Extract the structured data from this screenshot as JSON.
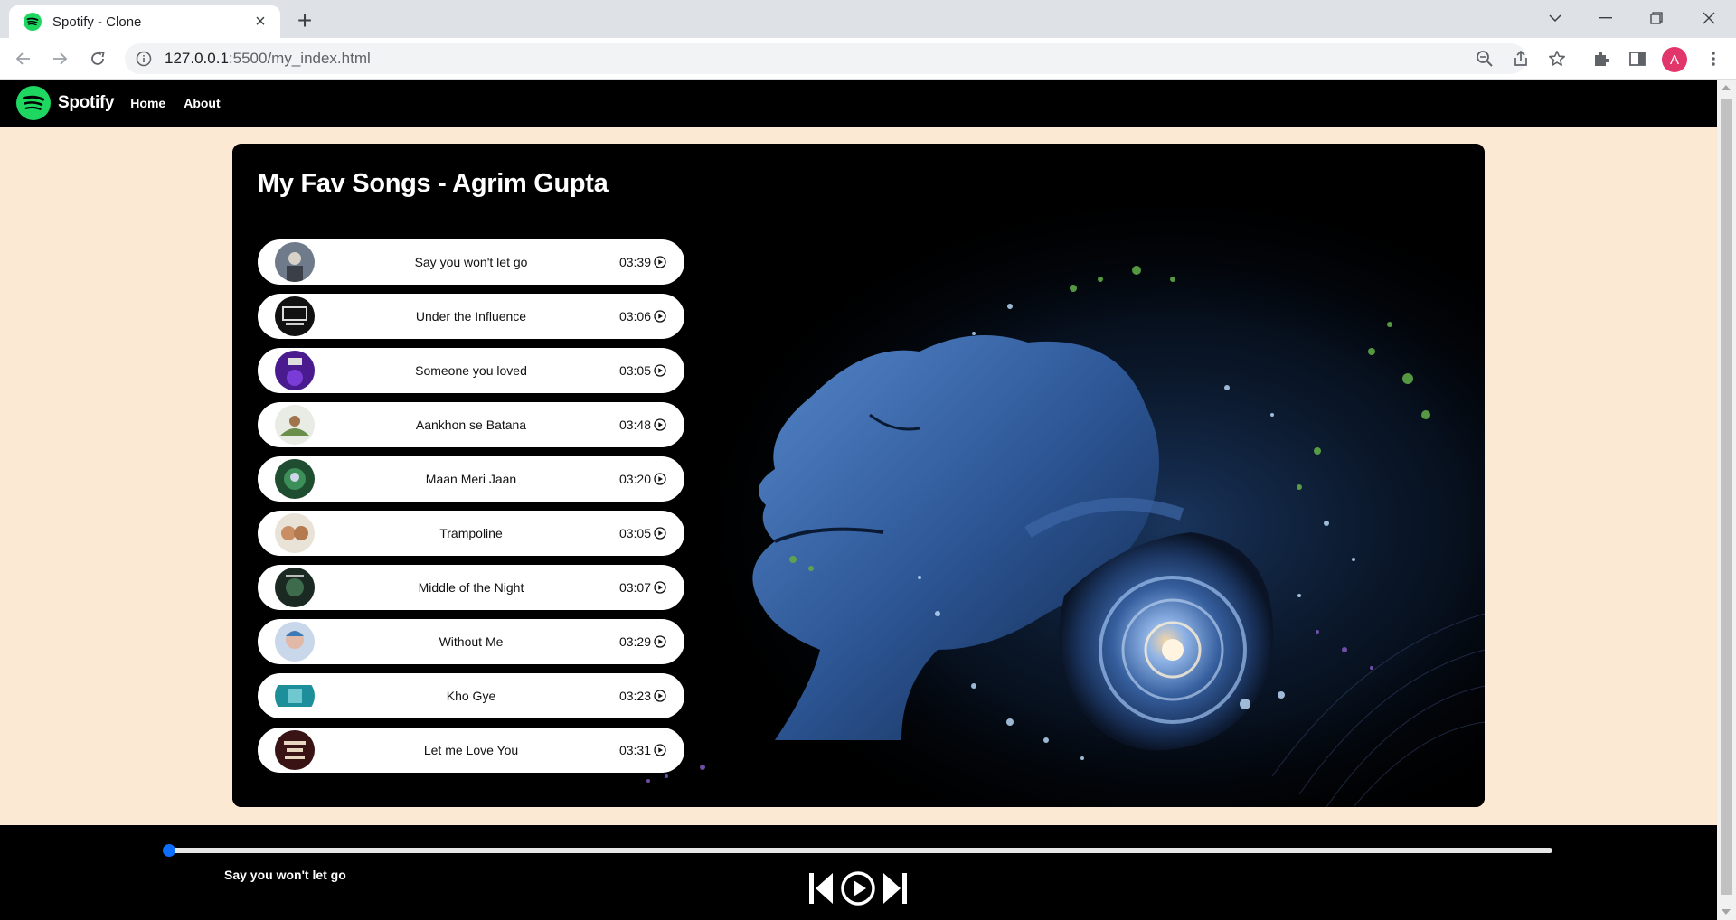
{
  "browser": {
    "tab_title": "Spotify - Clone",
    "url_host": "127.0.0.1",
    "url_rest": ":5500/my_index.html",
    "profile_initial": "A"
  },
  "site": {
    "brand": "Spotify",
    "nav": [
      {
        "label": "Home"
      },
      {
        "label": "About"
      }
    ]
  },
  "main": {
    "title": "My Fav Songs - Agrim Gupta",
    "songs": [
      {
        "name": "Say you won't let go",
        "duration": "03:39"
      },
      {
        "name": "Under the Influence",
        "duration": "03:06"
      },
      {
        "name": "Someone you loved",
        "duration": "03:05"
      },
      {
        "name": "Aankhon se Batana",
        "duration": "03:48"
      },
      {
        "name": "Maan Meri Jaan",
        "duration": "03:20"
      },
      {
        "name": "Trampoline",
        "duration": "03:05"
      },
      {
        "name": "Middle of the Night",
        "duration": "03:07"
      },
      {
        "name": "Without Me",
        "duration": "03:29"
      },
      {
        "name": "Kho Gye",
        "duration": "03:23"
      },
      {
        "name": "Let me Love You",
        "duration": "03:31"
      }
    ]
  },
  "player": {
    "now_playing": "Say you won't let go",
    "progress": 0
  },
  "colors": {
    "accent": "#0d6efd",
    "brand_green": "#1ed760",
    "page_bg": "#fbe9d3"
  }
}
